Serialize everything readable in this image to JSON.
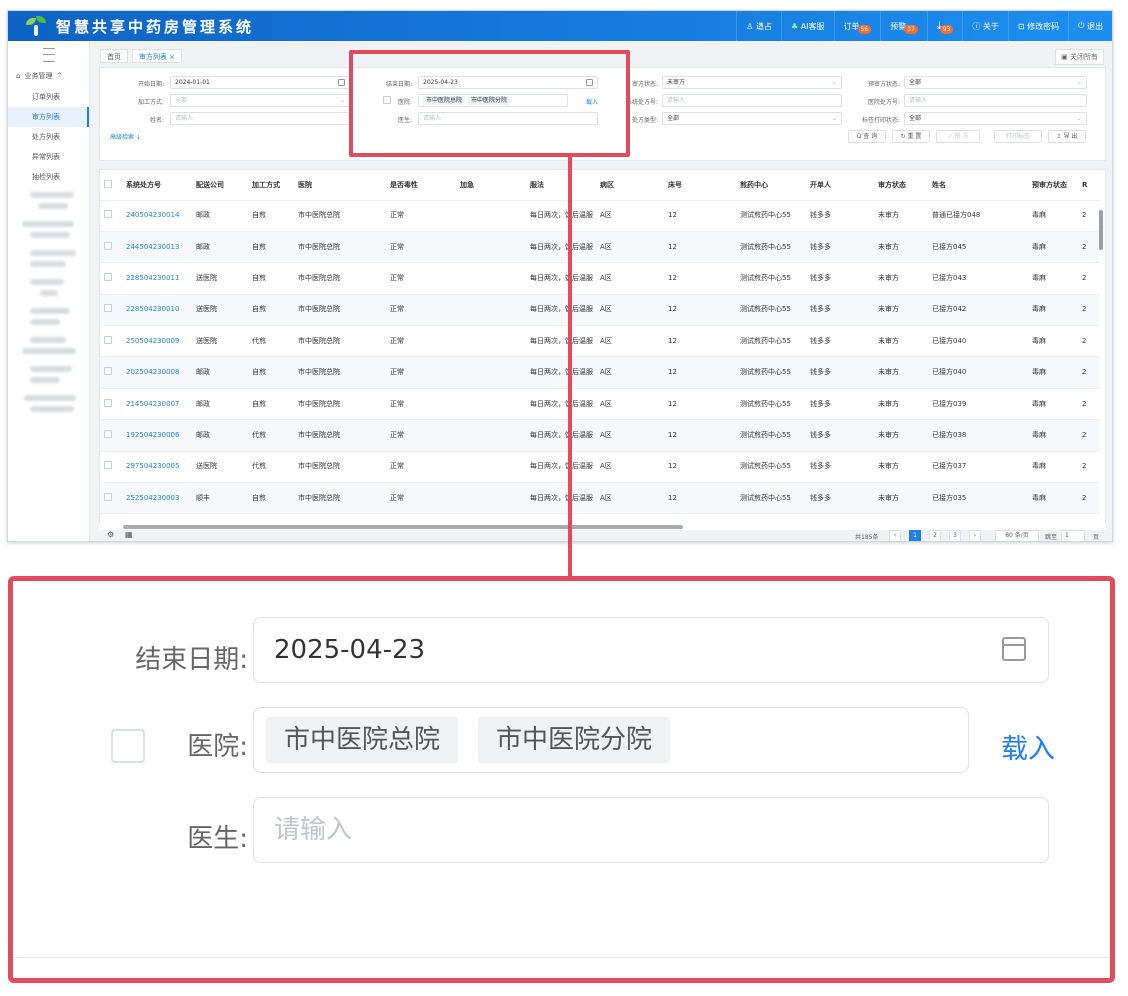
{
  "app": {
    "title": "智慧共享中药房管理系统",
    "header_items": [
      {
        "label": "遒占"
      },
      {
        "label": "AI客服"
      },
      {
        "label": "订单",
        "badge": "56"
      },
      {
        "label": "预警",
        "badge": "37"
      },
      {
        "label": "",
        "icon": "download-icon",
        "badge": "93"
      },
      {
        "label": "关于",
        "icon": "info-icon"
      },
      {
        "label": "修改密码",
        "icon": "lock-icon"
      },
      {
        "label": "退出",
        "icon": "logout-icon"
      }
    ]
  },
  "sidebar": {
    "group": "业务管理",
    "items": [
      "订单列表",
      "审方列表",
      "处方列表",
      "异常列表",
      "抽检列表"
    ],
    "active_index": 1
  },
  "tabs": {
    "home": "首页",
    "current": "审方列表 ×",
    "close_all": "关闭所有"
  },
  "filters": {
    "start_date_label": "开始日期:",
    "start_date": "2024-01-01",
    "process_label": "加工方式:",
    "process_placeholder": "全部",
    "name_label": "姓名:",
    "name_placeholder": "请输入",
    "advanced": "高级检索 ↓",
    "end_date_label": "结束日期:",
    "end_date": "2025-04-23",
    "hospital_label": "医院:",
    "hospital_chips": [
      "市中医院总院",
      "市中医院分院"
    ],
    "load": "载入",
    "doctor_label": "医生:",
    "doctor_placeholder": "请输入",
    "review_status_label": "审方状态:",
    "review_status": "未审方",
    "sys_no_label": "系统处方号:",
    "sys_no_placeholder": "请输入",
    "type_label": "处方类型:",
    "type": "全部",
    "warn_status_label": "预审方状态:",
    "warn_status": "全部",
    "hosp_no_label": "医院处方号:",
    "hosp_no_placeholder": "请输入",
    "print_label": "标签打印状态:",
    "print_status": "全部",
    "buttons": {
      "query": "Q 查 询",
      "reset": "↻ 重 置",
      "review": "✓ 审 方",
      "print": "打印标签",
      "export": "⇪ 导 出"
    }
  },
  "table": {
    "headers": [
      "系统处方号",
      "配送公司",
      "加工方式",
      "医院",
      "是否毒性",
      "加急",
      "服法",
      "病区",
      "床号",
      "煎药中心",
      "开单人",
      "审方状态",
      "姓名",
      "预审方状态",
      "R"
    ],
    "rows": [
      [
        "240504230014",
        "邮政",
        "自煎",
        "市中医院总院",
        "正常",
        "",
        "每日两次，饭后温服",
        "A区",
        "12",
        "测试煎药中心55",
        "钱多多",
        "未审方",
        "普通已接方048",
        "毒麻",
        "2"
      ],
      [
        "244504230013",
        "邮政",
        "自煎",
        "市中医院总院",
        "正常",
        "",
        "每日两次，饭后温服",
        "A区",
        "12",
        "测试煎药中心55",
        "钱多多",
        "未审方",
        "已接方045",
        "毒麻",
        "2"
      ],
      [
        "228504230011",
        "送医院",
        "自煎",
        "市中医院总院",
        "正常",
        "",
        "每日两次，饭后温服",
        "A区",
        "12",
        "测试煎药中心55",
        "钱多多",
        "未审方",
        "已接方043",
        "毒麻",
        "2"
      ],
      [
        "228504230010",
        "送医院",
        "自煎",
        "市中医院总院",
        "正常",
        "",
        "每日两次，饭后温服",
        "A区",
        "12",
        "测试煎药中心55",
        "钱多多",
        "未审方",
        "已接方042",
        "毒麻",
        "2"
      ],
      [
        "250504230009",
        "送医院",
        "代煎",
        "市中医院总院",
        "正常",
        "",
        "每日两次，饭后温服",
        "A区",
        "12",
        "测试煎药中心55",
        "钱多多",
        "未审方",
        "已接方040",
        "毒麻",
        "2"
      ],
      [
        "202504230008",
        "邮政",
        "自煎",
        "市中医院总院",
        "正常",
        "",
        "每日两次，饭后温服",
        "A区",
        "12",
        "测试煎药中心55",
        "钱多多",
        "未审方",
        "已接方040",
        "毒麻",
        "2"
      ],
      [
        "214504230007",
        "邮政",
        "自煎",
        "市中医院总院",
        "正常",
        "",
        "每日两次，饭后温服",
        "A区",
        "12",
        "测试煎药中心55",
        "钱多多",
        "未审方",
        "已接方039",
        "毒麻",
        "2"
      ],
      [
        "192504230006",
        "邮政",
        "代煎",
        "市中医院总院",
        "正常",
        "",
        "每日两次，饭后温服",
        "A区",
        "12",
        "测试煎药中心55",
        "钱多多",
        "未审方",
        "已接方038",
        "毒麻",
        "2"
      ],
      [
        "297504230005",
        "送医院",
        "代煎",
        "市中医院总院",
        "正常",
        "",
        "每日两次，饭后温服",
        "A区",
        "12",
        "测试煎药中心55",
        "钱多多",
        "未审方",
        "已接方037",
        "毒麻",
        "2"
      ],
      [
        "252504230003",
        "顺丰",
        "自煎",
        "市中医院总院",
        "正常",
        "",
        "每日两次，饭后温服",
        "A区",
        "12",
        "测试煎药中心55",
        "钱多多",
        "未审方",
        "已接方035",
        "毒麻",
        "2"
      ]
    ]
  },
  "pager": {
    "total": "共185条",
    "pages": [
      "1",
      "2",
      "3"
    ],
    "per_page": "80 条/页",
    "goto": "跳至",
    "goto_value": "1",
    "page_unit": "页"
  },
  "colors": {
    "primary": "#1e80e8",
    "header": "#0e63c4",
    "highlight": "#e04c5e"
  }
}
